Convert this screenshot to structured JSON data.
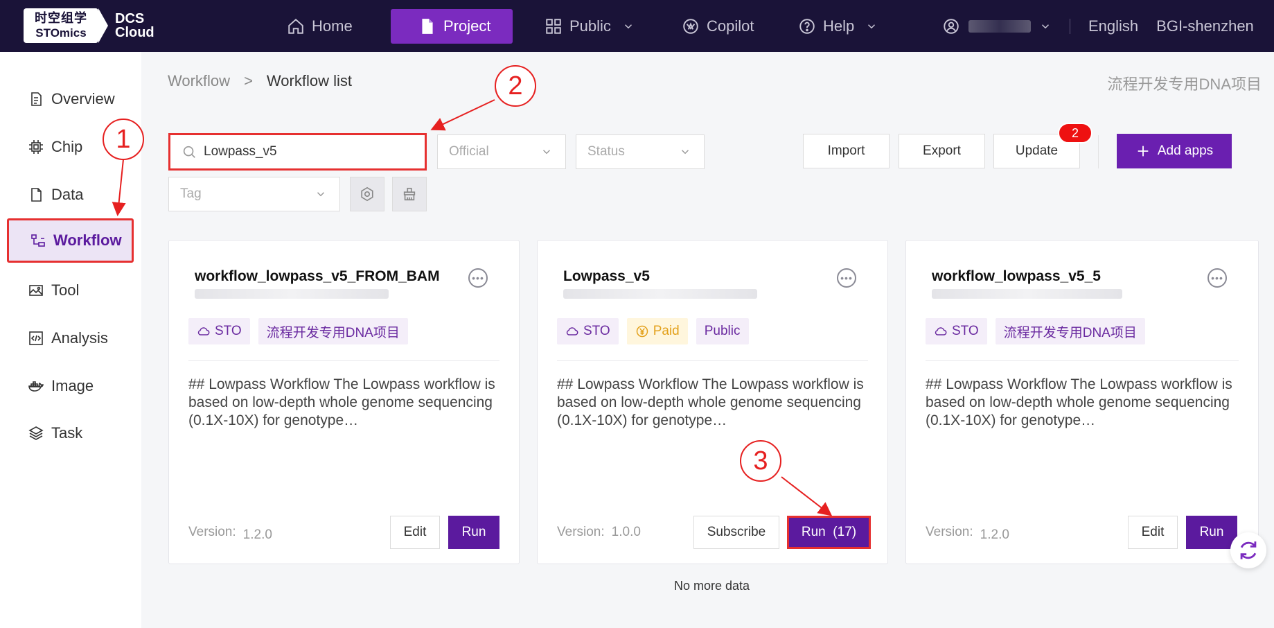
{
  "brand": {
    "logo_line1": "时空组学",
    "logo_line2": "STOmics",
    "product_line1": "DCS",
    "product_line2": "Cloud"
  },
  "nav": {
    "home": "Home",
    "project": "Project",
    "public": "Public",
    "copilot": "Copilot",
    "help": "Help",
    "language": "English",
    "org": "BGI-shenzhen"
  },
  "sidebar": {
    "items": [
      {
        "label": "Overview",
        "icon": "document-icon"
      },
      {
        "label": "Chip",
        "icon": "chip-icon"
      },
      {
        "label": "Data",
        "icon": "file-icon"
      },
      {
        "label": "Workflow",
        "icon": "workflow-icon"
      },
      {
        "label": "Tool",
        "icon": "image-tool-icon"
      },
      {
        "label": "Analysis",
        "icon": "code-icon"
      },
      {
        "label": "Image",
        "icon": "docker-icon"
      },
      {
        "label": "Task",
        "icon": "layers-icon"
      }
    ]
  },
  "breadcrumb": {
    "root": "Workflow",
    "current": "Workflow list"
  },
  "project_name": "流程开发专用DNA项目",
  "filters": {
    "search_value": "Lowpass_v5",
    "official": "Official",
    "status": "Status",
    "tag": "Tag"
  },
  "actions": {
    "import": "Import",
    "export": "Export",
    "update": "Update",
    "update_badge": "2",
    "add_apps": "Add apps"
  },
  "cards": [
    {
      "title": "workflow_lowpass_v5_FROM_BAM",
      "tags": [
        "STO",
        "流程开发专用DNA项目"
      ],
      "desc": "## Lowpass Workflow The Lowpass workflow is based on low-depth whole genome sequencing (0.1X-10X) for genotype…",
      "version_label": "Version:",
      "version": "1.2.0",
      "btn1": "Edit",
      "btn2": "Run"
    },
    {
      "title": "Lowpass_v5",
      "tags": [
        "STO",
        "Paid",
        "Public"
      ],
      "desc": "## Lowpass Workflow The Lowpass workflow is based on low-depth whole genome sequencing (0.1X-10X) for genotype…",
      "version_label": "Version:",
      "version": "1.0.0",
      "btn1": "Subscribe",
      "btn2": "Run  (17)"
    },
    {
      "title": "workflow_lowpass_v5_5",
      "tags": [
        "STO",
        "流程开发专用DNA项目"
      ],
      "desc": "## Lowpass Workflow The Lowpass workflow is based on low-depth whole genome sequencing (0.1X-10X) for genotype…",
      "version_label": "Version:",
      "version": "1.2.0",
      "btn1": "Edit",
      "btn2": "Run"
    }
  ],
  "footer": {
    "no_more": "No more data"
  },
  "annotations": {
    "step1": "1",
    "step2": "2",
    "step3": "3"
  },
  "colors": {
    "nav_bg": "#1a1338",
    "accent": "#6a1fb0",
    "highlight": "#e63030"
  }
}
